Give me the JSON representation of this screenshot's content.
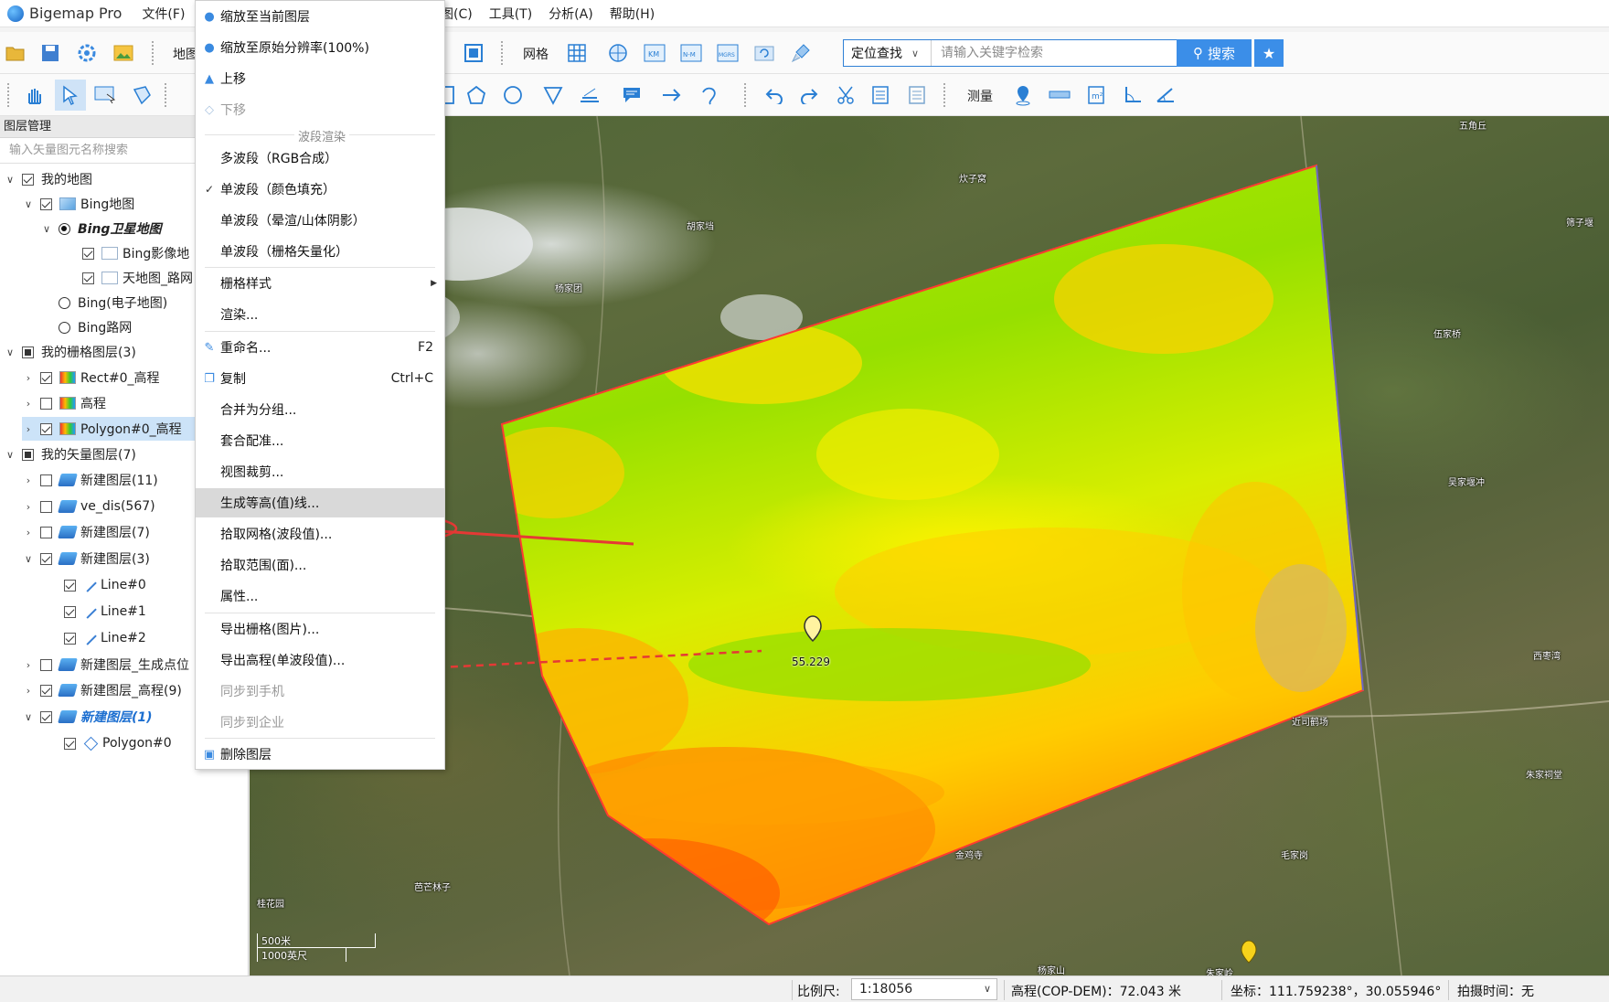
{
  "app": {
    "title": "Bigemap Pro"
  },
  "menu": {
    "left": [
      "文件(F)",
      "地"
    ],
    "right": [
      "图(C)",
      "工具(T)",
      "分析(A)",
      "帮助(H)"
    ]
  },
  "toolbar1": {
    "map_label": "地图",
    "grid_label": "网格",
    "search": {
      "type_label": "定位查找",
      "placeholder": "请输入关键字检索",
      "button_label": "搜索"
    }
  },
  "toolbar2": {
    "measure_label": "测量"
  },
  "panel": {
    "header": "图层管理",
    "search_placeholder": "输入矢量图元名称搜索",
    "tree": [
      {
        "label": "我的地图"
      },
      {
        "label": "Bing地图"
      },
      {
        "label": "Bing卫星地图"
      },
      {
        "label": "Bing影像地"
      },
      {
        "label": "天地图_路网"
      },
      {
        "label": "Bing(电子地图)"
      },
      {
        "label": "Bing路网"
      },
      {
        "label": "我的栅格图层(3)"
      },
      {
        "label": "Rect#0_高程"
      },
      {
        "label": "高程"
      },
      {
        "label": "Polygon#0_高程"
      },
      {
        "label": "我的矢量图层(7)"
      },
      {
        "label": "新建图层(11)"
      },
      {
        "label": "ve_dis(567)"
      },
      {
        "label": "新建图层(7)"
      },
      {
        "label": "新建图层(3)"
      },
      {
        "label": "Line#0"
      },
      {
        "label": "Line#1"
      },
      {
        "label": "Line#2"
      },
      {
        "label": "新建图层_生成点位"
      },
      {
        "label": "新建图层_高程(9)"
      },
      {
        "label": "新建图层(1)"
      },
      {
        "label": "Polygon#0"
      }
    ]
  },
  "context_menu": {
    "items": [
      {
        "label": "缩放至当前图层"
      },
      {
        "label": "缩放至原始分辨率(100%)"
      },
      {
        "label": "上移"
      },
      {
        "label": "下移"
      },
      {
        "label": "多波段（RGB合成）"
      },
      {
        "label": "单波段（颜色填充）"
      },
      {
        "label": "单波段（晕渲/山体阴影）"
      },
      {
        "label": "单波段（栅格矢量化）"
      },
      {
        "label": "栅格样式"
      },
      {
        "label": "渲染..."
      },
      {
        "label": "重命名...",
        "shortcut": "F2"
      },
      {
        "label": "复制",
        "shortcut": "Ctrl+C"
      },
      {
        "label": "合并为分组..."
      },
      {
        "label": "套合配准..."
      },
      {
        "label": "视图裁剪..."
      },
      {
        "label": "生成等高(值)线..."
      },
      {
        "label": "拾取网格(波段值)..."
      },
      {
        "label": "拾取范围(面)..."
      },
      {
        "label": "属性..."
      },
      {
        "label": "导出栅格(图片)..."
      },
      {
        "label": "导出高程(单波段值)..."
      },
      {
        "label": "同步到手机"
      },
      {
        "label": "同步到企业"
      },
      {
        "label": "删除图层"
      }
    ],
    "group_label": "波段渲染"
  },
  "map": {
    "marker_value": "55.229",
    "places": [
      "五角丘",
      "炊子窝",
      "胡家垱",
      "筛子堰",
      "杨家团",
      "伍家桥",
      "吴家堰冲",
      "西枣湾",
      "近司鹤场",
      "朱家祠堂",
      "毛家岗",
      "金鸡寺",
      "芭芒林子",
      "桂花园",
      "杨家山",
      "朱家岭"
    ],
    "scale_top": "500米",
    "scale_bottom": "1000英尺",
    "colors": {
      "ramp_low": "#f30000",
      "ramp_mid": "#fff100",
      "ramp_high": "#7ee000",
      "arrow": "#e53935",
      "line": "#ff3b30"
    }
  },
  "status": {
    "scale_label": "比例尺:",
    "scale_value": "1:18056",
    "elevation": "高程(COP-DEM)：72.043 米",
    "coords": "坐标：111.759238°，30.055946°",
    "capture_time": "拍摄时间：无"
  }
}
